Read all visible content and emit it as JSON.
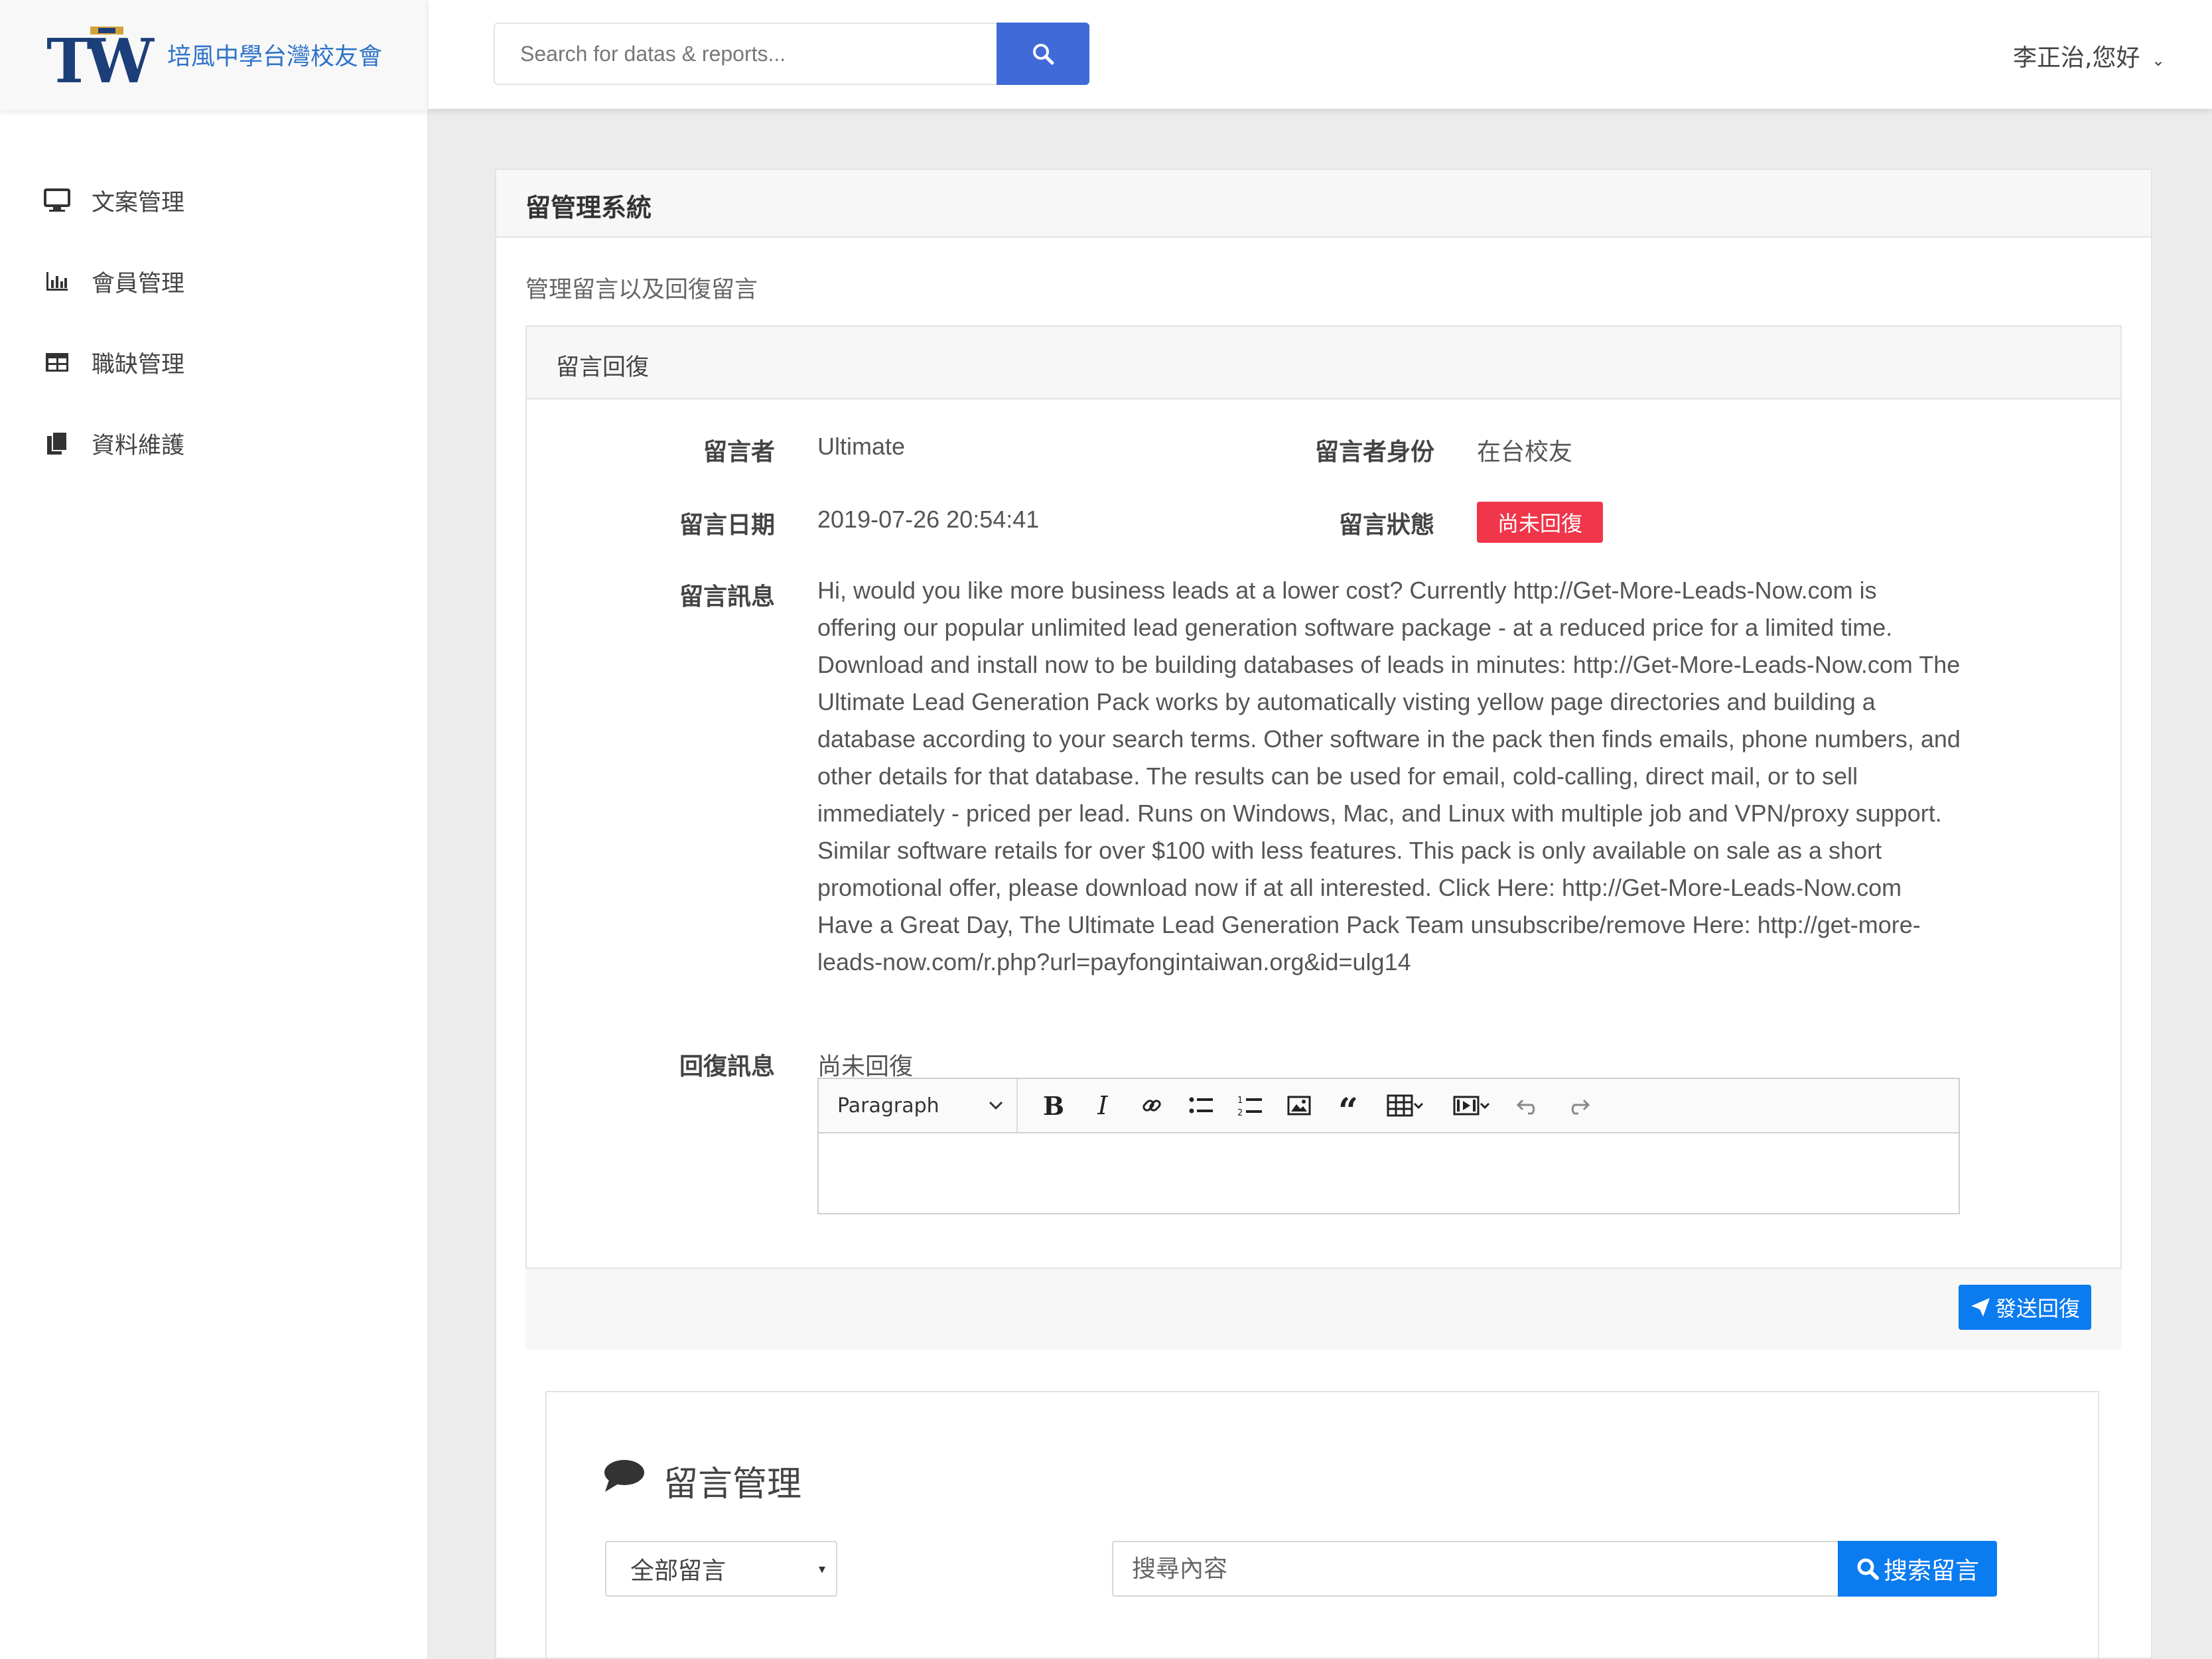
{
  "brand": {
    "logo_text": "TW",
    "name": "培風中學台灣校友會",
    "color": "#2f73c9"
  },
  "search": {
    "placeholder": "Search for datas & reports..."
  },
  "user": {
    "greeting": "李正治,您好"
  },
  "sidebar": {
    "items": [
      {
        "label": "文案管理",
        "icon": "monitor-icon"
      },
      {
        "label": "會員管理",
        "icon": "bar-chart-icon"
      },
      {
        "label": "職缺管理",
        "icon": "table-icon"
      },
      {
        "label": "資料維護",
        "icon": "copy-icon"
      }
    ]
  },
  "main": {
    "title": "留管理系統",
    "subtitle": "管理留言以及回復留言"
  },
  "reply": {
    "panel_title": "留言回復",
    "author_label": "留言者",
    "author_value": "Ultimate",
    "identity_label": "留言者身份",
    "identity_value": "在台校友",
    "date_label": "留言日期",
    "date_value": "2019-07-26 20:54:41",
    "status_label": "留言狀態",
    "status_value": "尚未回復",
    "message_label": "留言訊息",
    "message_value": "Hi, would you like more business leads at a lower cost? Currently http://Get-More-Leads-Now.com is offering our popular unlimited lead generation software package - at a reduced price for a limited time. Download and install now to be building databases of leads in minutes: http://Get-More-Leads-Now.com The Ultimate Lead Generation Pack works by automatically visting yellow page directories and building a database according to your search terms. Other software in the pack then finds emails, phone numbers, and other details for that database. The results can be used for email, cold-calling, direct mail, or to sell immediately - priced per lead. Runs on Windows, Mac, and Linux with multiple job and VPN/proxy support. Similar software retails for over $100 with less features. This pack is only available on sale as a short promotional offer, please download now if at all interested. Click Here: http://Get-More-Leads-Now.com Have a Great Day, The Ultimate Lead Generation Pack Team unsubscribe/remove Here: http://get-more-leads-now.com/r.php?url=payfongintaiwan.org&id=ulg14",
    "reply_label": "回復訊息",
    "reply_value": "尚未回復",
    "editor_format": "Paragraph",
    "send_label": "發送回復",
    "status_color": "#f0364a",
    "accent": "#0b7bf0"
  },
  "management": {
    "title": "留言管理",
    "filter_value": "全部留言",
    "search_placeholder": "搜尋內容",
    "search_label": "搜索留言"
  }
}
